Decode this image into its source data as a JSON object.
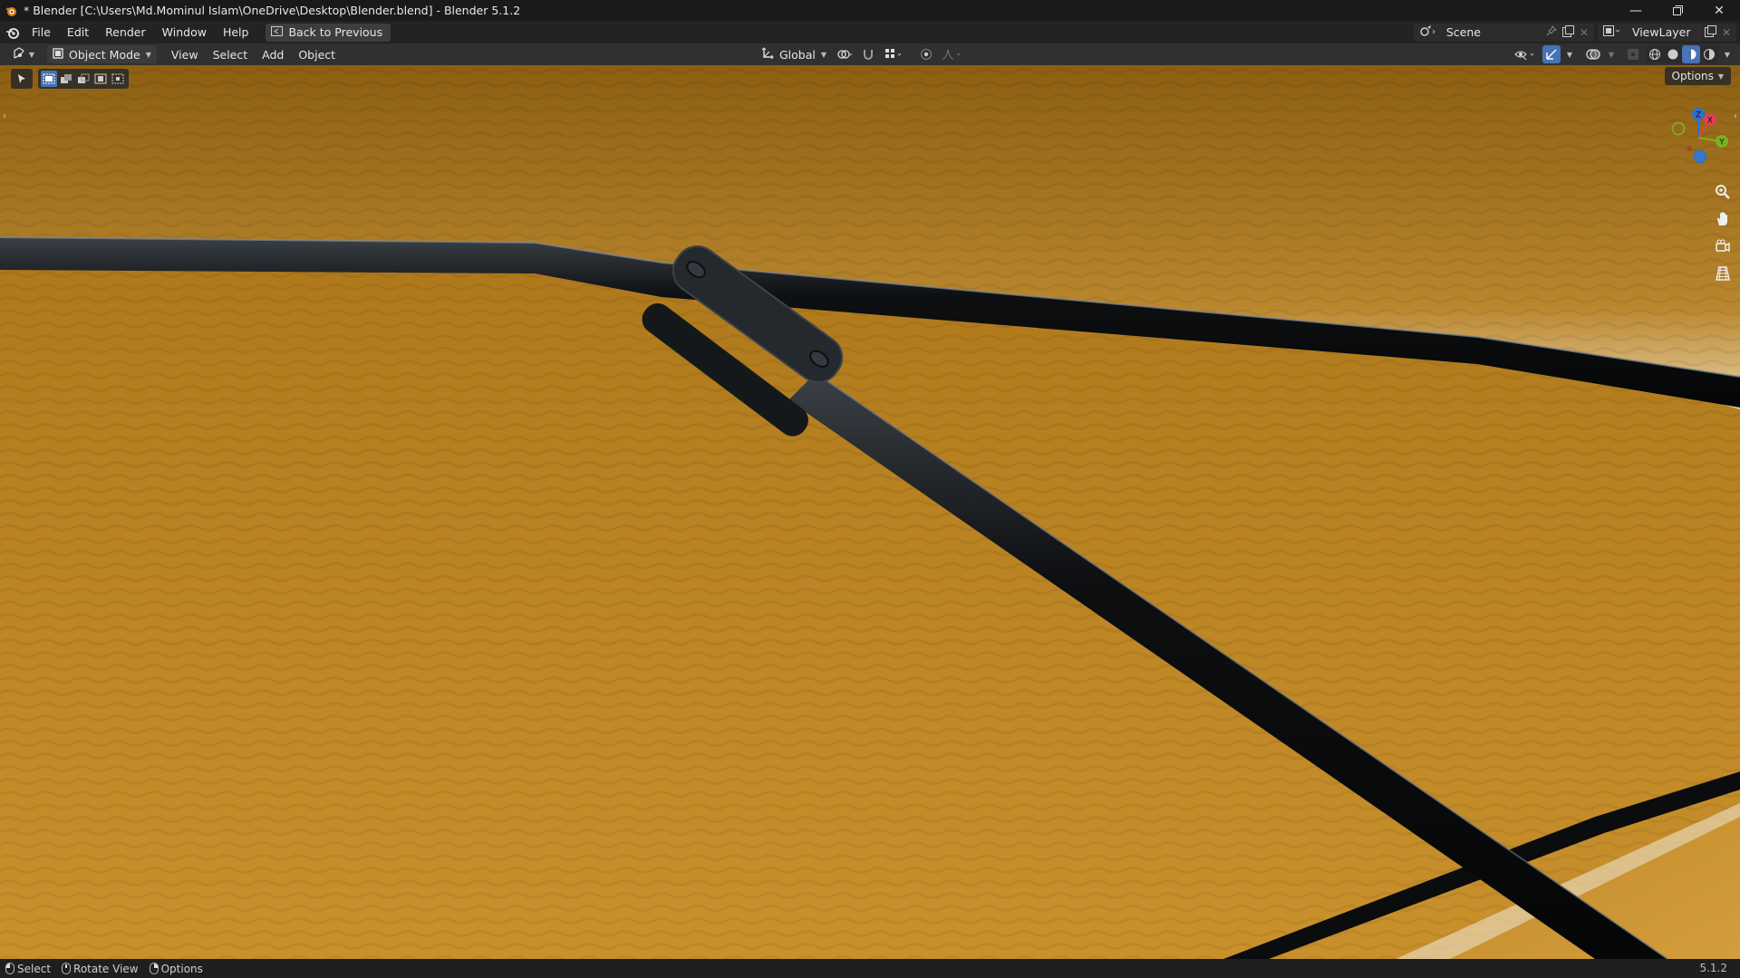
{
  "window": {
    "title": "* Blender [C:\\Users\\Md.Mominul Islam\\OneDrive\\Desktop\\Blender.blend] - Blender 5.1.2",
    "controls": [
      "minimize-icon",
      "maximize-icon",
      "close-icon"
    ]
  },
  "topbar": {
    "menus": [
      "File",
      "Edit",
      "Render",
      "Window",
      "Help"
    ],
    "back_button": "Back to Previous",
    "scene": "Scene",
    "view_layer": "ViewLayer"
  },
  "viewport_header": {
    "mode": "Object Mode",
    "menus": [
      "View",
      "Select",
      "Add",
      "Object"
    ],
    "orientation": "Global",
    "options_label": "Options"
  },
  "statusbar": {
    "items": [
      "Select",
      "Rotate View",
      "Options"
    ],
    "version": "5.1.2"
  },
  "colors": {
    "accent": "#4772b3",
    "surface": "#b07a1c"
  },
  "gizmo": {
    "axes": [
      "Z",
      "X",
      "Y"
    ]
  }
}
